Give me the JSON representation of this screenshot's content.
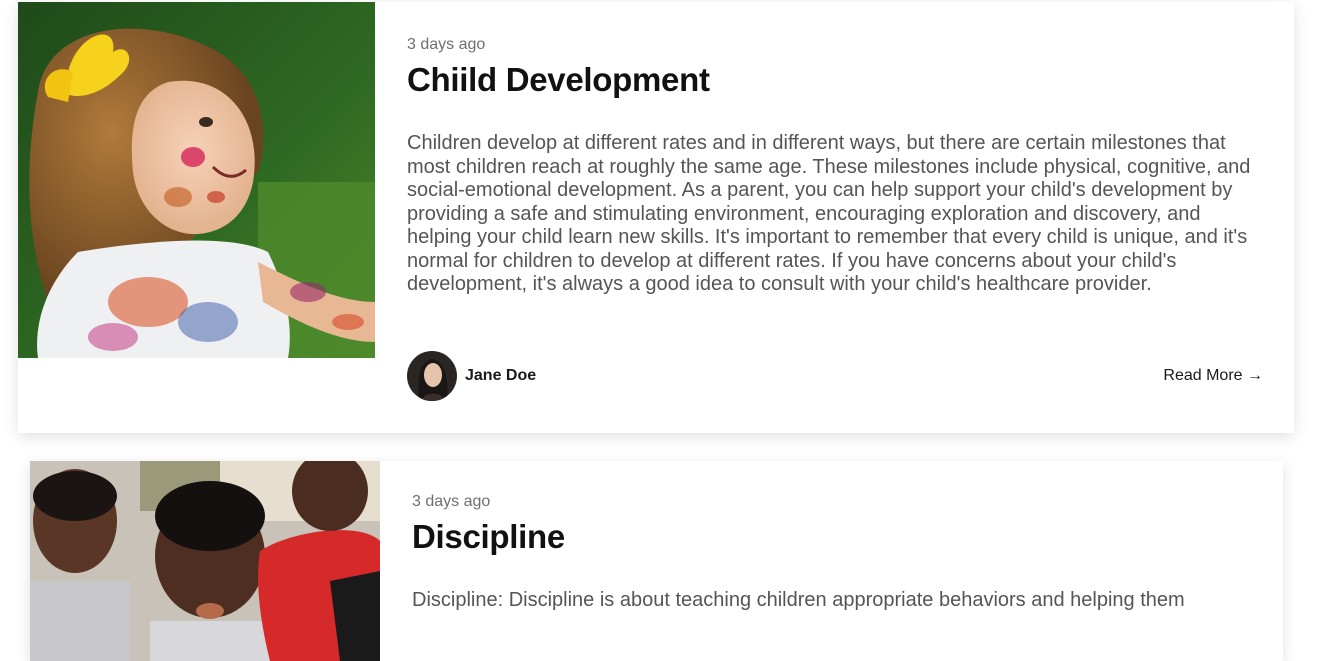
{
  "posts": [
    {
      "meta": "3 days ago",
      "title": "Chiild Development",
      "excerpt": "Children develop at different rates and in different ways, but there are certain milestones that most children reach at roughly the same age. These milestones include physical, cognitive, and social-emotional development. As a parent, you can help support your child's development by providing a safe and stimulating environment, encouraging exploration and discovery, and helping your child learn new skills. It's important to remember that every child is unique, and it's normal for children to develop at different rates. If you have concerns about your child's development, it's always a good idea to consult with your child's healthcare provider.",
      "author": "Jane Doe",
      "read_more": "Read More →"
    },
    {
      "meta": "3 days ago",
      "title": "Discipline",
      "excerpt": "Discipline: Discipline is about teaching children appropriate behaviors and helping them"
    }
  ],
  "colors": {
    "title": "#111111",
    "meta": "#6f6f6f",
    "excerpt": "#555555",
    "card_bg": "#ffffff"
  },
  "icons": {
    "read_more_arrow": "arrow-right-icon"
  }
}
